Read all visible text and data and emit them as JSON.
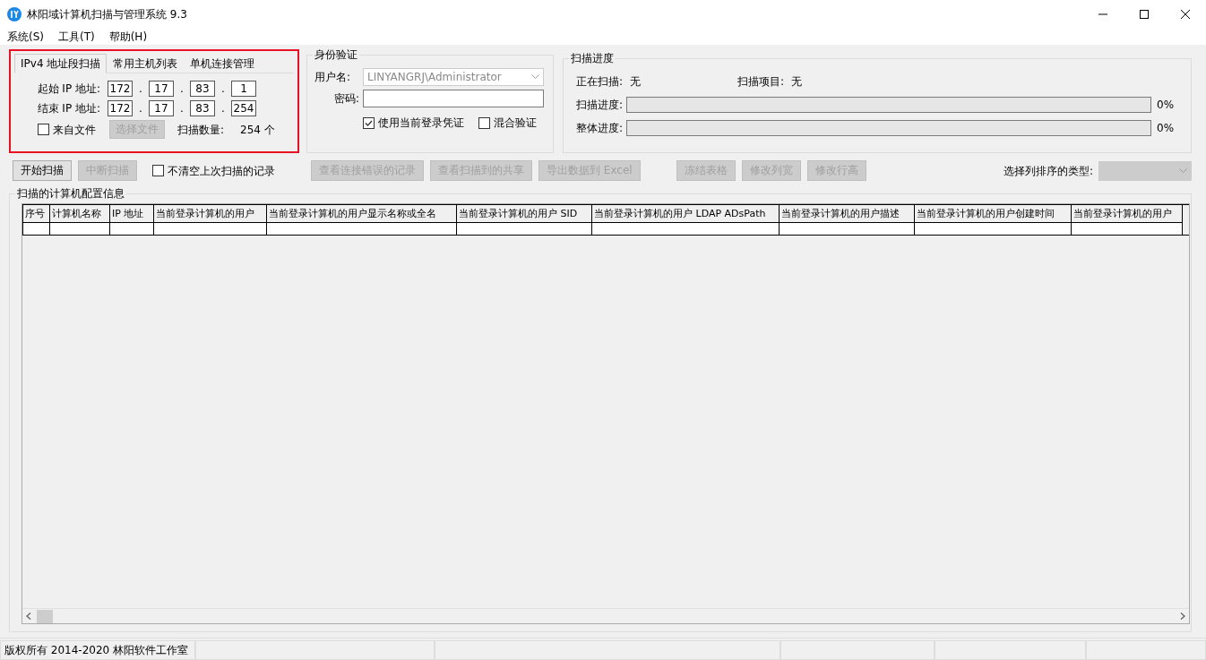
{
  "window": {
    "title": "林阳域计算机扫描与管理系统 9.3"
  },
  "menu": [
    "系统(S)",
    "工具(T)",
    "帮助(H)"
  ],
  "ip_panel": {
    "tabs": [
      {
        "label": "IPv4 地址段扫描",
        "selected": true
      },
      {
        "label": "常用主机列表",
        "selected": false
      },
      {
        "label": "单机连接管理",
        "selected": false
      }
    ],
    "rows": [
      {
        "label": "起始 IP 地址:",
        "octets": [
          "172",
          "17",
          "83",
          "1"
        ],
        "separators": [
          ".",
          ".",
          "."
        ]
      },
      {
        "label": "结束 IP 地址:",
        "octets": [
          "172",
          "17",
          "83",
          "254"
        ],
        "separators": [
          ".",
          ".",
          "."
        ]
      }
    ],
    "from_file": {
      "label": "来自文件",
      "checked": false
    },
    "choose_file": {
      "label": "选择文件",
      "disabled": true
    },
    "count_label": "扫描数量:",
    "count": "254 个"
  },
  "auth": {
    "title": "身份验证",
    "username_label": "用户名:",
    "username": "LINYANGRJ\\Administrator",
    "username_disabled": true,
    "password_label": "密码:",
    "options": [
      {
        "label": "使用当前登录凭证",
        "checked": true
      },
      {
        "label": "混合验证",
        "checked": false
      }
    ]
  },
  "progress": {
    "title": "扫描进度",
    "scanning_label": "正在扫描:",
    "scanning": "无",
    "item_label": "扫描项目:",
    "item": "无",
    "bars": [
      {
        "label": "扫描进度:",
        "level": 0,
        "reading": "0%"
      },
      {
        "label": "整体进度:",
        "level": 0,
        "reading": "0%"
      }
    ]
  },
  "toolbar": [
    [
      {
        "kind": "button",
        "label": "开始扫描",
        "disabled": false
      },
      {
        "kind": "button",
        "label": "中断扫描",
        "disabled": true
      },
      {
        "kind": "checkbox",
        "label": "不清空上次扫描的记录",
        "checked": false
      }
    ],
    [
      {
        "kind": "button",
        "label": "查看连接错误的记录",
        "disabled": true
      },
      {
        "kind": "button",
        "label": "查看扫描到的共享",
        "disabled": true
      },
      {
        "kind": "button",
        "label": "导出数据到 Excel",
        "disabled": true
      }
    ],
    [
      {
        "kind": "button",
        "label": "冻结表格",
        "disabled": true
      },
      {
        "kind": "button",
        "label": "修改列宽",
        "disabled": true
      },
      {
        "kind": "button",
        "label": "修改行高",
        "disabled": true
      }
    ]
  ],
  "sort": {
    "label": "选择列排序的类型:",
    "disabled": true
  },
  "table": {
    "title": "扫描的计算机配置信息",
    "columns": [
      "序号",
      "计算机名称",
      "IP 地址",
      "当前登录计算机的用户",
      "当前登录计算机的用户显示名称或全名",
      "当前登录计算机的用户 SID",
      "当前登录计算机的用户 LDAP ADsPath",
      "当前登录计算机的用户描述",
      "当前登录计算机的用户创建时间",
      "当前登录计算机的用户"
    ]
  },
  "status_bar": [
    "版权所有 2014-2020 林阳软件工作室"
  ]
}
